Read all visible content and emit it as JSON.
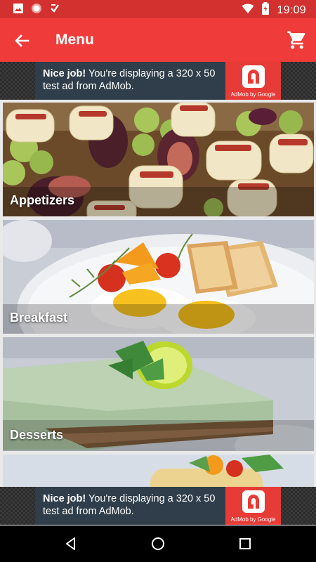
{
  "status_bar": {
    "time": "19:09",
    "icons": [
      "image-icon",
      "circle-icon",
      "check-icon",
      "wifi-icon",
      "battery-icon"
    ]
  },
  "app_bar": {
    "title": "Menu",
    "back_icon": "arrow-back-icon",
    "cart_icon": "cart-icon"
  },
  "ads": {
    "top": {
      "headline": "Nice job!",
      "body": " You're displaying a 320 x 50 test ad from AdMob.",
      "brand": "AdMob by Google"
    },
    "bottom": {
      "headline": "Nice job!",
      "body": " You're displaying a 320 x 50 test ad from AdMob.",
      "brand": "AdMob by Google"
    }
  },
  "menu": {
    "categories": [
      {
        "label": "Appetizers"
      },
      {
        "label": "Breakfast"
      },
      {
        "label": "Desserts"
      }
    ]
  },
  "colors": {
    "status_bar": "#d3312f",
    "app_bar": "#ef3c3a",
    "ad_background": "#2f3e4a",
    "ad_logo": "#e63b36"
  }
}
